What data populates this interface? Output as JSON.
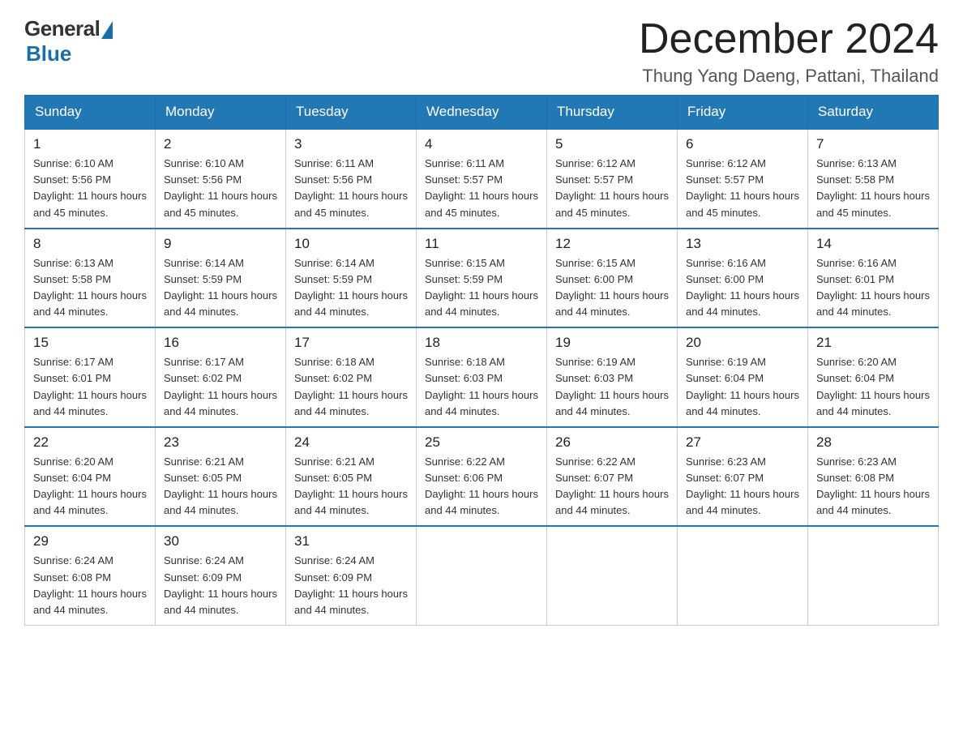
{
  "header": {
    "logo_general": "General",
    "logo_blue": "Blue",
    "month_title": "December 2024",
    "location": "Thung Yang Daeng, Pattani, Thailand"
  },
  "weekdays": [
    "Sunday",
    "Monday",
    "Tuesday",
    "Wednesday",
    "Thursday",
    "Friday",
    "Saturday"
  ],
  "weeks": [
    [
      {
        "day": "1",
        "sunrise": "6:10 AM",
        "sunset": "5:56 PM",
        "daylight": "11 hours and 45 minutes."
      },
      {
        "day": "2",
        "sunrise": "6:10 AM",
        "sunset": "5:56 PM",
        "daylight": "11 hours and 45 minutes."
      },
      {
        "day": "3",
        "sunrise": "6:11 AM",
        "sunset": "5:56 PM",
        "daylight": "11 hours and 45 minutes."
      },
      {
        "day": "4",
        "sunrise": "6:11 AM",
        "sunset": "5:57 PM",
        "daylight": "11 hours and 45 minutes."
      },
      {
        "day": "5",
        "sunrise": "6:12 AM",
        "sunset": "5:57 PM",
        "daylight": "11 hours and 45 minutes."
      },
      {
        "day": "6",
        "sunrise": "6:12 AM",
        "sunset": "5:57 PM",
        "daylight": "11 hours and 45 minutes."
      },
      {
        "day": "7",
        "sunrise": "6:13 AM",
        "sunset": "5:58 PM",
        "daylight": "11 hours and 45 minutes."
      }
    ],
    [
      {
        "day": "8",
        "sunrise": "6:13 AM",
        "sunset": "5:58 PM",
        "daylight": "11 hours and 44 minutes."
      },
      {
        "day": "9",
        "sunrise": "6:14 AM",
        "sunset": "5:59 PM",
        "daylight": "11 hours and 44 minutes."
      },
      {
        "day": "10",
        "sunrise": "6:14 AM",
        "sunset": "5:59 PM",
        "daylight": "11 hours and 44 minutes."
      },
      {
        "day": "11",
        "sunrise": "6:15 AM",
        "sunset": "5:59 PM",
        "daylight": "11 hours and 44 minutes."
      },
      {
        "day": "12",
        "sunrise": "6:15 AM",
        "sunset": "6:00 PM",
        "daylight": "11 hours and 44 minutes."
      },
      {
        "day": "13",
        "sunrise": "6:16 AM",
        "sunset": "6:00 PM",
        "daylight": "11 hours and 44 minutes."
      },
      {
        "day": "14",
        "sunrise": "6:16 AM",
        "sunset": "6:01 PM",
        "daylight": "11 hours and 44 minutes."
      }
    ],
    [
      {
        "day": "15",
        "sunrise": "6:17 AM",
        "sunset": "6:01 PM",
        "daylight": "11 hours and 44 minutes."
      },
      {
        "day": "16",
        "sunrise": "6:17 AM",
        "sunset": "6:02 PM",
        "daylight": "11 hours and 44 minutes."
      },
      {
        "day": "17",
        "sunrise": "6:18 AM",
        "sunset": "6:02 PM",
        "daylight": "11 hours and 44 minutes."
      },
      {
        "day": "18",
        "sunrise": "6:18 AM",
        "sunset": "6:03 PM",
        "daylight": "11 hours and 44 minutes."
      },
      {
        "day": "19",
        "sunrise": "6:19 AM",
        "sunset": "6:03 PM",
        "daylight": "11 hours and 44 minutes."
      },
      {
        "day": "20",
        "sunrise": "6:19 AM",
        "sunset": "6:04 PM",
        "daylight": "11 hours and 44 minutes."
      },
      {
        "day": "21",
        "sunrise": "6:20 AM",
        "sunset": "6:04 PM",
        "daylight": "11 hours and 44 minutes."
      }
    ],
    [
      {
        "day": "22",
        "sunrise": "6:20 AM",
        "sunset": "6:04 PM",
        "daylight": "11 hours and 44 minutes."
      },
      {
        "day": "23",
        "sunrise": "6:21 AM",
        "sunset": "6:05 PM",
        "daylight": "11 hours and 44 minutes."
      },
      {
        "day": "24",
        "sunrise": "6:21 AM",
        "sunset": "6:05 PM",
        "daylight": "11 hours and 44 minutes."
      },
      {
        "day": "25",
        "sunrise": "6:22 AM",
        "sunset": "6:06 PM",
        "daylight": "11 hours and 44 minutes."
      },
      {
        "day": "26",
        "sunrise": "6:22 AM",
        "sunset": "6:07 PM",
        "daylight": "11 hours and 44 minutes."
      },
      {
        "day": "27",
        "sunrise": "6:23 AM",
        "sunset": "6:07 PM",
        "daylight": "11 hours and 44 minutes."
      },
      {
        "day": "28",
        "sunrise": "6:23 AM",
        "sunset": "6:08 PM",
        "daylight": "11 hours and 44 minutes."
      }
    ],
    [
      {
        "day": "29",
        "sunrise": "6:24 AM",
        "sunset": "6:08 PM",
        "daylight": "11 hours and 44 minutes."
      },
      {
        "day": "30",
        "sunrise": "6:24 AM",
        "sunset": "6:09 PM",
        "daylight": "11 hours and 44 minutes."
      },
      {
        "day": "31",
        "sunrise": "6:24 AM",
        "sunset": "6:09 PM",
        "daylight": "11 hours and 44 minutes."
      },
      null,
      null,
      null,
      null
    ]
  ],
  "labels": {
    "sunrise": "Sunrise:",
    "sunset": "Sunset:",
    "daylight": "Daylight:"
  }
}
